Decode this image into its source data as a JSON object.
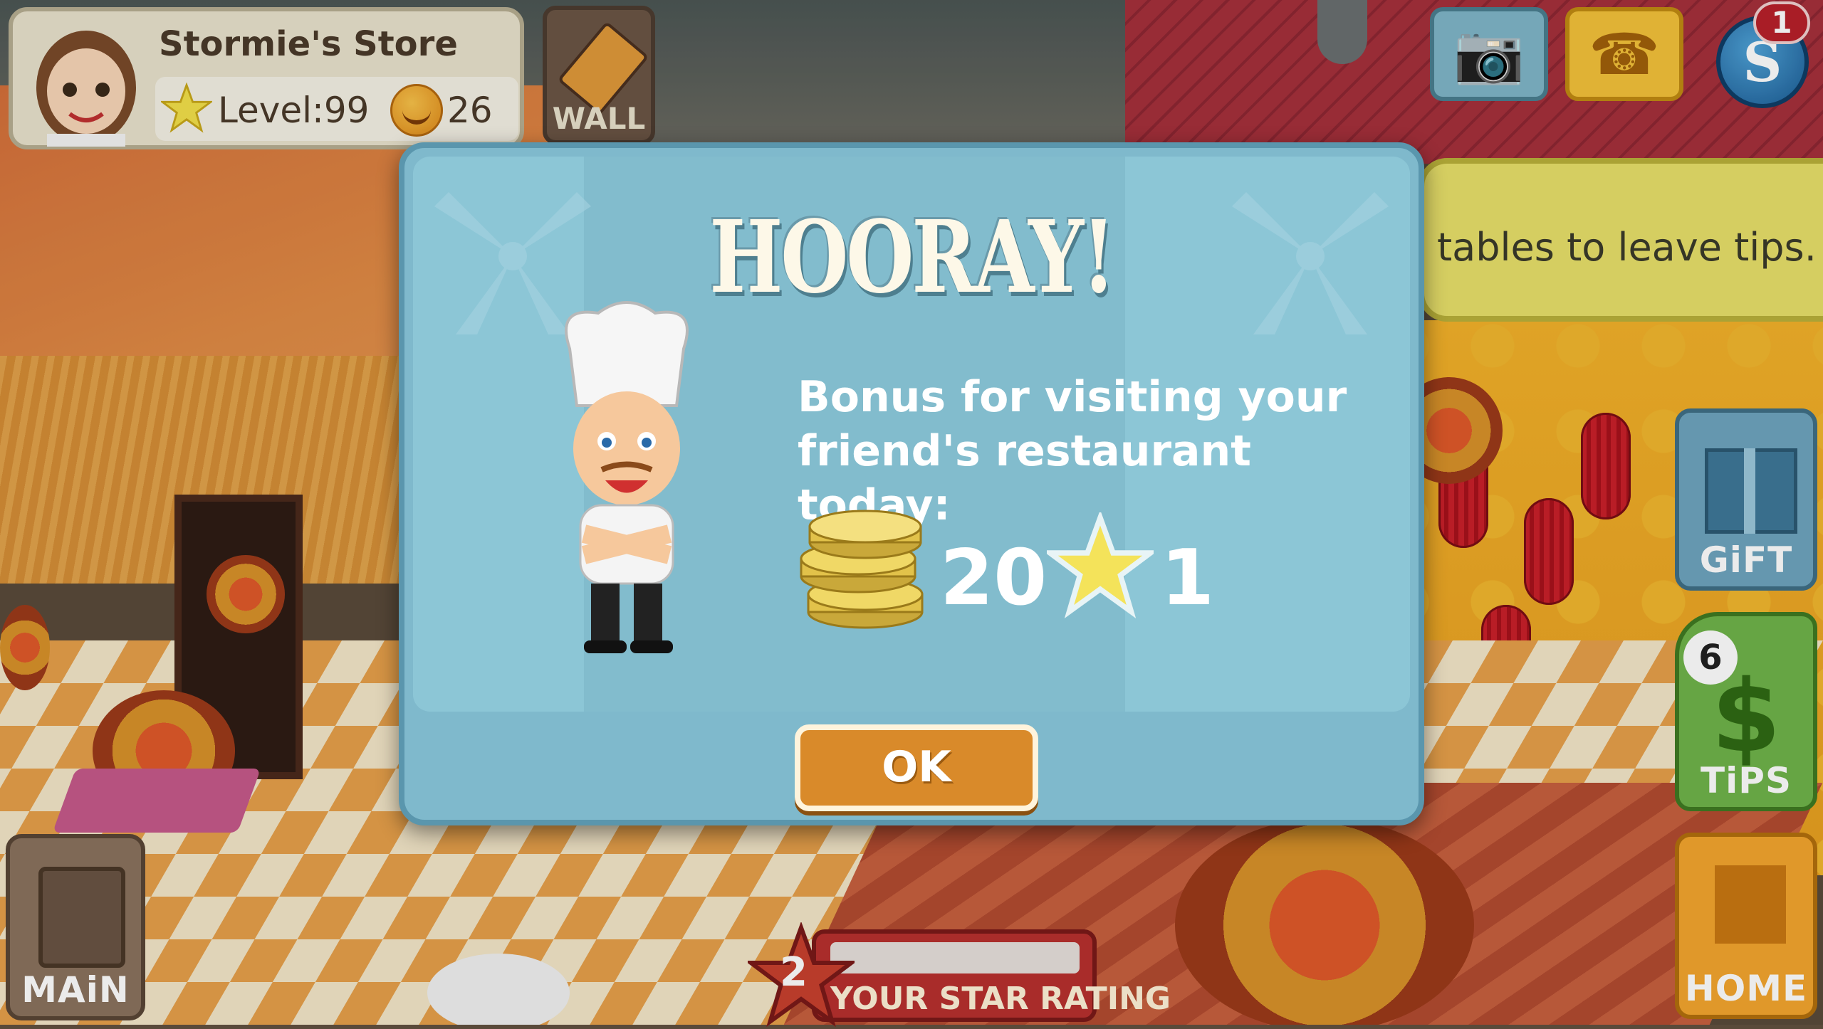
{
  "profile": {
    "store_name": "Stormie's Store",
    "level_label": "Level:",
    "level_value": "99",
    "smiles": "26"
  },
  "toolbar": {
    "wall_label": "WALL",
    "notification_count": "1",
    "currency_symbol": "S"
  },
  "tip_bubble": {
    "text": "tables to leave tips."
  },
  "side_buttons": {
    "gift_label": "GiFT",
    "tips_label": "TiPS",
    "tips_count": "6",
    "home_label": "HOME",
    "main_label": "MAiN"
  },
  "star_rating": {
    "value": "2",
    "label": "YOUR STAR RATING"
  },
  "dialog": {
    "title": "HOORAY!",
    "message_line1": "Bonus for visiting your",
    "message_line2": "friend's restaurant today:",
    "coins_reward": "20",
    "stars_reward": "1",
    "ok_label": "OK"
  },
  "colors": {
    "dialog_bg": "#7fb9cc",
    "ok_button": "#d98a2a",
    "star": "#f4e35a"
  },
  "icons": [
    "chef-avatar-icon",
    "star-icon",
    "smile-coin-icon",
    "pencil-icon",
    "camera-icon",
    "phone-icon",
    "s-coin-icon",
    "gift-icon",
    "dollar-icon",
    "house-icon",
    "clipboard-icon",
    "coin-stack-icon"
  ]
}
